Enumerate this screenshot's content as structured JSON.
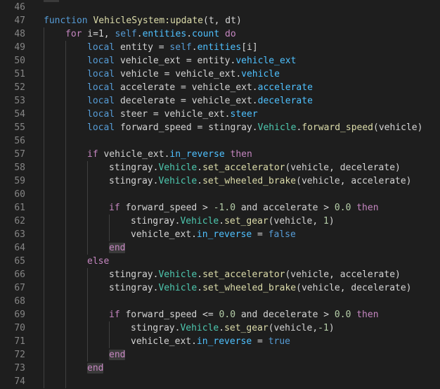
{
  "editor": {
    "lines": [
      {
        "n": "46",
        "indent": 0,
        "tokens": []
      },
      {
        "n": "47",
        "indent": 0,
        "tokens": [
          [
            "kw",
            "function"
          ],
          [
            "op",
            " "
          ],
          [
            "fn",
            "VehicleSystem:update"
          ],
          [
            "op",
            "(t, dt)"
          ]
        ]
      },
      {
        "n": "48",
        "indent": 1,
        "tokens": [
          [
            "ctl",
            "for"
          ],
          [
            "op",
            " i=1, "
          ],
          [
            "kw",
            "self"
          ],
          [
            "op",
            "."
          ],
          [
            "prop",
            "entities"
          ],
          [
            "op",
            "."
          ],
          [
            "prop",
            "count"
          ],
          [
            "op",
            " "
          ],
          [
            "ctl",
            "do"
          ]
        ]
      },
      {
        "n": "49",
        "indent": 2,
        "tokens": [
          [
            "kw",
            "local"
          ],
          [
            "op",
            " entity = "
          ],
          [
            "kw",
            "self"
          ],
          [
            "op",
            "."
          ],
          [
            "prop",
            "entities"
          ],
          [
            "op",
            "[i]"
          ]
        ]
      },
      {
        "n": "50",
        "indent": 2,
        "tokens": [
          [
            "kw",
            "local"
          ],
          [
            "op",
            " vehicle_ext = entity."
          ],
          [
            "prop",
            "vehicle_ext"
          ]
        ]
      },
      {
        "n": "51",
        "indent": 2,
        "tokens": [
          [
            "kw",
            "local"
          ],
          [
            "op",
            " vehicle = vehicle_ext."
          ],
          [
            "prop",
            "vehicle"
          ]
        ]
      },
      {
        "n": "52",
        "indent": 2,
        "tokens": [
          [
            "kw",
            "local"
          ],
          [
            "op",
            " accelerate = vehicle_ext."
          ],
          [
            "prop",
            "accelerate"
          ]
        ]
      },
      {
        "n": "53",
        "indent": 2,
        "tokens": [
          [
            "kw",
            "local"
          ],
          [
            "op",
            " decelerate = vehicle_ext."
          ],
          [
            "prop",
            "decelerate"
          ]
        ]
      },
      {
        "n": "54",
        "indent": 2,
        "tokens": [
          [
            "kw",
            "local"
          ],
          [
            "op",
            " steer = vehicle_ext."
          ],
          [
            "prop",
            "steer"
          ]
        ]
      },
      {
        "n": "55",
        "indent": 2,
        "tokens": [
          [
            "kw",
            "local"
          ],
          [
            "op",
            " forward_speed = stingray."
          ],
          [
            "cls",
            "Vehicle"
          ],
          [
            "op",
            "."
          ],
          [
            "fn",
            "forward_speed"
          ],
          [
            "op",
            "(vehicle)"
          ]
        ]
      },
      {
        "n": "56",
        "indent": 0,
        "tokens": []
      },
      {
        "n": "57",
        "indent": 2,
        "tokens": [
          [
            "ctl",
            "if"
          ],
          [
            "op",
            " vehicle_ext."
          ],
          [
            "prop",
            "in_reverse"
          ],
          [
            "op",
            " "
          ],
          [
            "ctl",
            "then"
          ]
        ]
      },
      {
        "n": "58",
        "indent": 3,
        "tokens": [
          [
            "op",
            "stingray."
          ],
          [
            "cls",
            "Vehicle"
          ],
          [
            "op",
            "."
          ],
          [
            "fn",
            "set_accelerator"
          ],
          [
            "op",
            "(vehicle, decelerate)"
          ]
        ]
      },
      {
        "n": "59",
        "indent": 3,
        "tokens": [
          [
            "op",
            "stingray."
          ],
          [
            "cls",
            "Vehicle"
          ],
          [
            "op",
            "."
          ],
          [
            "fn",
            "set_wheeled_brake"
          ],
          [
            "op",
            "(vehicle, accelerate)"
          ]
        ]
      },
      {
        "n": "60",
        "indent": 0,
        "tokens": []
      },
      {
        "n": "61",
        "indent": 3,
        "tokens": [
          [
            "ctl",
            "if"
          ],
          [
            "op",
            " forward_speed > "
          ],
          [
            "num",
            "-1.0"
          ],
          [
            "op",
            " and accelerate > "
          ],
          [
            "num",
            "0.0"
          ],
          [
            "op",
            " "
          ],
          [
            "ctl",
            "then"
          ]
        ]
      },
      {
        "n": "62",
        "indent": 4,
        "tokens": [
          [
            "op",
            "stingray."
          ],
          [
            "cls",
            "Vehicle"
          ],
          [
            "op",
            "."
          ],
          [
            "fn",
            "set_gear"
          ],
          [
            "op",
            "(vehicle, "
          ],
          [
            "num",
            "1"
          ],
          [
            "op",
            ")"
          ]
        ]
      },
      {
        "n": "63",
        "indent": 4,
        "tokens": [
          [
            "op",
            "vehicle_ext."
          ],
          [
            "prop",
            "in_reverse"
          ],
          [
            "op",
            " = "
          ],
          [
            "bool",
            "false"
          ]
        ]
      },
      {
        "n": "64",
        "indent": 3,
        "tokens": [
          [
            "ctl hl",
            "end"
          ]
        ]
      },
      {
        "n": "65",
        "indent": 2,
        "tokens": [
          [
            "ctl",
            "else"
          ]
        ]
      },
      {
        "n": "66",
        "indent": 3,
        "tokens": [
          [
            "op",
            "stingray."
          ],
          [
            "cls",
            "Vehicle"
          ],
          [
            "op",
            "."
          ],
          [
            "fn",
            "set_accelerator"
          ],
          [
            "op",
            "(vehicle, accelerate)"
          ]
        ]
      },
      {
        "n": "67",
        "indent": 3,
        "tokens": [
          [
            "op",
            "stingray."
          ],
          [
            "cls",
            "Vehicle"
          ],
          [
            "op",
            "."
          ],
          [
            "fn",
            "set_wheeled_brake"
          ],
          [
            "op",
            "(vehicle, decelerate)"
          ]
        ]
      },
      {
        "n": "68",
        "indent": 0,
        "tokens": []
      },
      {
        "n": "69",
        "indent": 3,
        "tokens": [
          [
            "ctl",
            "if"
          ],
          [
            "op",
            " forward_speed <= "
          ],
          [
            "num",
            "0.0"
          ],
          [
            "op",
            " and decelerate > "
          ],
          [
            "num",
            "0.0"
          ],
          [
            "op",
            " "
          ],
          [
            "ctl",
            "then"
          ]
        ]
      },
      {
        "n": "70",
        "indent": 4,
        "tokens": [
          [
            "op",
            "stingray."
          ],
          [
            "cls",
            "Vehicle"
          ],
          [
            "op",
            "."
          ],
          [
            "fn",
            "set_gear"
          ],
          [
            "op",
            "(vehicle,"
          ],
          [
            "num",
            "-1"
          ],
          [
            "op",
            ")"
          ]
        ]
      },
      {
        "n": "71",
        "indent": 4,
        "tokens": [
          [
            "op",
            "vehicle_ext."
          ],
          [
            "prop",
            "in_reverse"
          ],
          [
            "op",
            " = "
          ],
          [
            "bool",
            "true"
          ]
        ]
      },
      {
        "n": "72",
        "indent": 3,
        "tokens": [
          [
            "ctl hl",
            "end"
          ]
        ]
      },
      {
        "n": "73",
        "indent": 2,
        "tokens": [
          [
            "ctl hl",
            "end"
          ]
        ]
      },
      {
        "n": "74",
        "indent": 0,
        "tokens": []
      }
    ]
  }
}
